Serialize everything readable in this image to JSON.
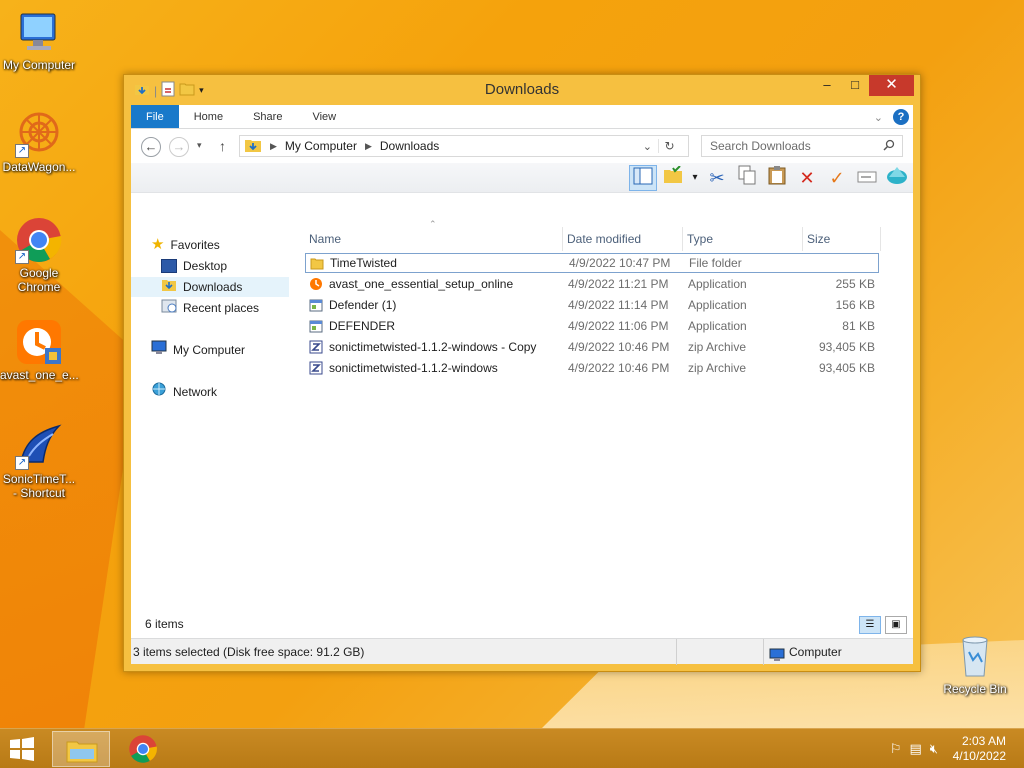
{
  "desktop": {
    "icons": [
      {
        "label": "My Computer"
      },
      {
        "label": "DataWagon..."
      },
      {
        "label": "Google Chrome"
      },
      {
        "label": "avast_one_e..."
      },
      {
        "label": "SonicTimeT... - Shortcut"
      },
      {
        "label": "Recycle Bin"
      }
    ]
  },
  "window": {
    "title": "Downloads",
    "controls": {
      "minimize": "–",
      "maximize": "□",
      "close": "✕"
    },
    "ribbon_tabs": [
      "File",
      "Home",
      "Share",
      "View"
    ],
    "address": {
      "crumbs": [
        "My Computer",
        "Downloads"
      ],
      "search_placeholder": "Search Downloads"
    },
    "nav": {
      "favorites": "Favorites",
      "desktop": "Desktop",
      "downloads": "Downloads",
      "recent": "Recent places",
      "computer": "My Computer",
      "network": "Network"
    },
    "columns": {
      "name": "Name",
      "date": "Date modified",
      "type": "Type",
      "size": "Size"
    },
    "files": [
      {
        "name": "TimeTwisted",
        "date": "4/9/2022 10:47 PM",
        "type": "File folder",
        "size": "",
        "icon": "folder-icon"
      },
      {
        "name": "avast_one_essential_setup_online",
        "date": "4/9/2022 11:21 PM",
        "type": "Application",
        "size": "255 KB",
        "icon": "avast-icon"
      },
      {
        "name": "Defender (1)",
        "date": "4/9/2022 11:14 PM",
        "type": "Application",
        "size": "156 KB",
        "icon": "app-icon"
      },
      {
        "name": "DEFENDER",
        "date": "4/9/2022 11:06 PM",
        "type": "Application",
        "size": "81 KB",
        "icon": "app-icon"
      },
      {
        "name": "sonictimetwisted-1.1.2-windows - Copy",
        "date": "4/9/2022 10:46 PM",
        "type": "zip Archive",
        "size": "93,405 KB",
        "icon": "zip-icon"
      },
      {
        "name": "sonictimetwisted-1.1.2-windows",
        "date": "4/9/2022 10:46 PM",
        "type": "zip Archive",
        "size": "93,405 KB",
        "icon": "zip-icon"
      }
    ],
    "status": {
      "item_count": "6 items",
      "selection": "3 items selected (Disk free space: 91.2 GB)",
      "location": "Computer"
    }
  },
  "taskbar": {
    "time": "2:03 AM",
    "date": "4/10/2022"
  }
}
